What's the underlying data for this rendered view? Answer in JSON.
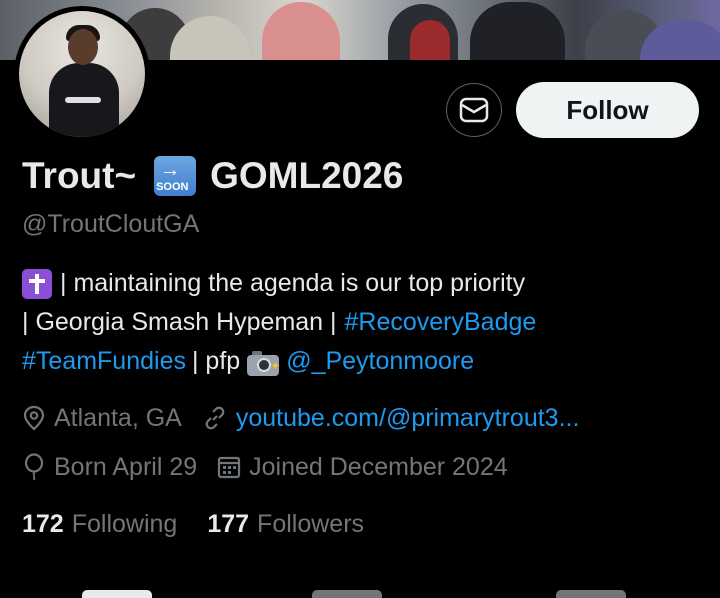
{
  "profile": {
    "display_name": "Trout~",
    "badge_text": "SOON",
    "display_name_suffix": "GOML2026",
    "handle": "@TroutCloutGA",
    "bio_line1_text": "| maintaining the agenda is our top priority",
    "bio_line2_text": "| Georgia Smash Hypeman |",
    "bio_line2_hashtag": "#RecoveryBadge",
    "bio_line3_hashtag": "#TeamFundies",
    "bio_line3_text": "| pfp",
    "bio_line3_mention": "@_Peytonmoore",
    "location": "Atlanta, GA",
    "website": "youtube.com/@primarytrout3...",
    "birthday": "Born April 29",
    "joined": "Joined December 2024",
    "following_count": "172",
    "following_label": "Following",
    "followers_count": "177",
    "followers_label": "Followers"
  },
  "actions": {
    "follow_label": "Follow"
  },
  "icons": {
    "message": "envelope-icon",
    "location": "location-pin-icon",
    "website": "link-icon",
    "birthday": "balloon-icon",
    "joined": "calendar-icon",
    "bio_start": "latin-cross-emoji",
    "camera": "camera-flash-emoji",
    "name_badge": "soon-arrow-emoji"
  },
  "colors": {
    "background": "#000000",
    "primary_text": "#e7e9ea",
    "secondary_text": "#71767b",
    "link": "#1d9bf0",
    "follow_button_bg": "#eff3f4",
    "follow_button_text": "#0f1419"
  }
}
